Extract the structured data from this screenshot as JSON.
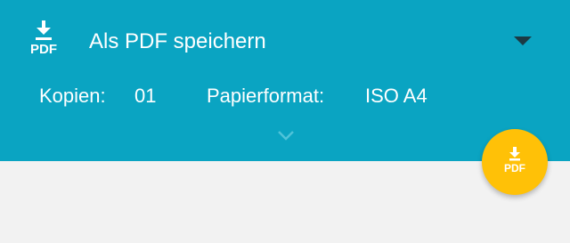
{
  "header": {
    "icon_label": "PDF",
    "printer_name": "Als PDF speichern",
    "background_color": "#0aa4c2"
  },
  "options": {
    "copies_label": "Kopien:",
    "copies_value": "01",
    "paper_label": "Papierformat:",
    "paper_value": "ISO A4"
  },
  "fab": {
    "label": "PDF",
    "color": "#ffc107"
  }
}
